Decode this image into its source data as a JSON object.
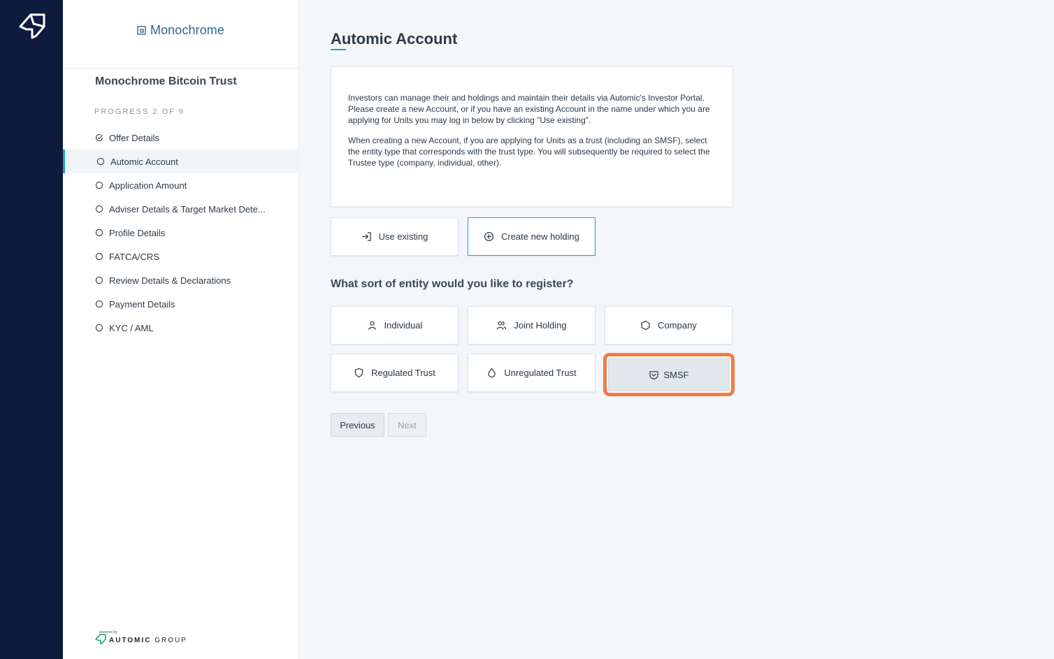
{
  "app": {
    "brand_name": "Monochrome"
  },
  "sidebar": {
    "offer_title": "Monochrome Bitcoin Trust",
    "progress_label": "PROGRESS 2 OF 9",
    "progress": {
      "current": 2,
      "total": 9
    },
    "steps": [
      {
        "label": "Offer Details",
        "status": "complete"
      },
      {
        "label": "Automic Account",
        "status": "active"
      },
      {
        "label": "Application Amount",
        "status": "pending"
      },
      {
        "label": "Adviser Details & Target Market Dete...",
        "status": "pending"
      },
      {
        "label": "Profile Details",
        "status": "pending"
      },
      {
        "label": "FATCA/CRS",
        "status": "pending"
      },
      {
        "label": "Review Details & Declarations",
        "status": "pending"
      },
      {
        "label": "Payment Details",
        "status": "pending"
      },
      {
        "label": "KYC / AML",
        "status": "pending"
      }
    ],
    "powered_by": {
      "small": "powered by",
      "brand_bold": "AUTOMIC",
      "brand_light": "GROUP"
    }
  },
  "main": {
    "title": "Automic Account",
    "info_paragraphs": [
      "Investors can manage their and holdings and maintain their details via Automic's Investor Portal. Please create a new Account, or if you have an existing Account in the name under which you are applying for Units you may log in below by clicking \"Use existing\".",
      "When creating a new Account, if you are applying for Units as a trust (including an SMSF), select the entity type that corresponds with the trust type. You will subsequently be required to select the Trustee type (company, individual, other)."
    ],
    "account_options": [
      {
        "label": "Use existing",
        "icon": "sign-in-icon",
        "selected": false
      },
      {
        "label": "Create new holding",
        "icon": "plus-circle-icon",
        "selected": true
      }
    ],
    "entity_question": "What sort of entity would you like to register?",
    "entity_options": [
      {
        "label": "Individual",
        "icon": "person-icon"
      },
      {
        "label": "Joint Holding",
        "icon": "people-icon"
      },
      {
        "label": "Company",
        "icon": "hexagon-icon"
      },
      {
        "label": "Regulated Trust",
        "icon": "shield-icon"
      },
      {
        "label": "Unregulated Trust",
        "icon": "drop-icon"
      },
      {
        "label": "SMSF",
        "icon": "pocket-shield-icon",
        "highlighted": true
      }
    ],
    "buttons": {
      "previous": "Previous",
      "next": "Next"
    }
  },
  "colors": {
    "rail": "#0f1a3f",
    "accent": "#1fa3b8",
    "highlight": "#f47a3f",
    "brand": "#2c6c8f"
  }
}
